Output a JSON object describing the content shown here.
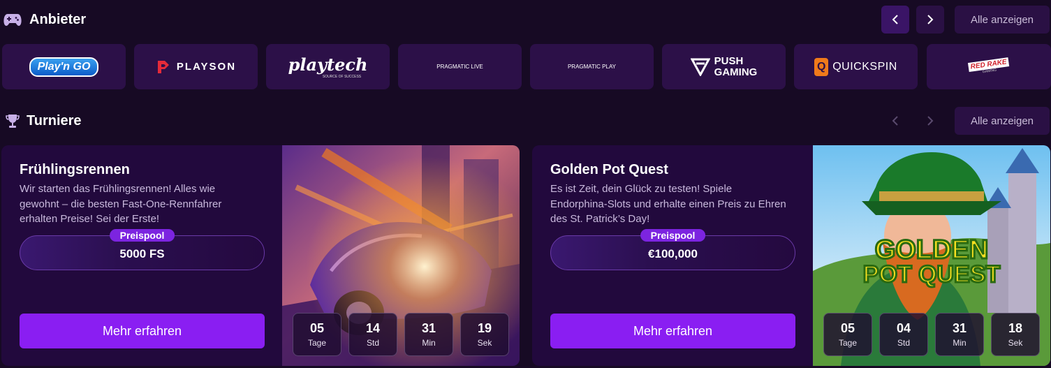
{
  "providers_section": {
    "title": "Anbieter",
    "icon": "gamepad-icon",
    "all_label": "Alle anzeigen",
    "items": [
      {
        "name": "Play'n GO"
      },
      {
        "name": "PLAYSON"
      },
      {
        "name": "playtech",
        "sub": "SOURCE OF SUCCESS"
      },
      {
        "name": "PRAGMATIC LIVE"
      },
      {
        "name": "PRAGMATIC PLAY"
      },
      {
        "name": "PUSH",
        "sub": "GAMING"
      },
      {
        "name": "QUICKSPIN"
      },
      {
        "name": "RED RAKE",
        "sub": "GAMING"
      }
    ]
  },
  "tournaments_section": {
    "title": "Turniere",
    "icon": "trophy-icon",
    "all_label": "Alle anzeigen",
    "cards": [
      {
        "title": "Frühlingsrennen",
        "description": "Wir starten das Frühlingsrennen! Alles wie gewohnt – die besten Fast-One-Rennfahrer erhalten Preise! Sei der Erste!",
        "pool_label": "Preispool",
        "pool_value": "5000 FS",
        "button": "Mehr erfahren",
        "timer": [
          {
            "value": "05",
            "unit": "Tage"
          },
          {
            "value": "14",
            "unit": "Std"
          },
          {
            "value": "31",
            "unit": "Min"
          },
          {
            "value": "19",
            "unit": "Sek"
          }
        ]
      },
      {
        "title": "Golden Pot Quest",
        "description": "Es ist Zeit, dein Glück zu testen! Spiele Endorphina-Slots und erhalte einen Preis zu Ehren des St. Patrick’s Day!",
        "pool_label": "Preispool",
        "pool_value": "€100,000",
        "button": "Mehr erfahren",
        "image_title_line1": "GOLDEN",
        "image_title_line2": "POT QUEST",
        "timer": [
          {
            "value": "05",
            "unit": "Tage"
          },
          {
            "value": "04",
            "unit": "Std"
          },
          {
            "value": "31",
            "unit": "Min"
          },
          {
            "value": "18",
            "unit": "Sek"
          }
        ]
      }
    ]
  },
  "colors": {
    "background": "#170a24",
    "card": "#22093d",
    "accent": "#8a1ef2",
    "tile": "#2c1048"
  }
}
